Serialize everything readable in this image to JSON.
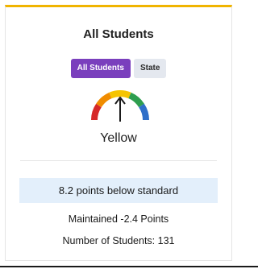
{
  "card": {
    "title": "All Students",
    "accent_color": "#f0b400",
    "toggle": {
      "options": [
        {
          "label": "All Students",
          "selected": true
        },
        {
          "label": "State",
          "selected": false
        }
      ],
      "active_color": "#7a3fbd"
    },
    "gauge": {
      "icon": "gauge-icon",
      "segments": [
        "#d62828",
        "#f08c00",
        "#f5c400",
        "#2e9e4f",
        "#2f6fc9"
      ],
      "needle_level": "Yellow"
    },
    "performance_color_label": "Yellow",
    "status_text": "8.2 points below standard",
    "change_text": "Maintained -2.4 Points",
    "student_count_text": "Number of Students: 131"
  }
}
